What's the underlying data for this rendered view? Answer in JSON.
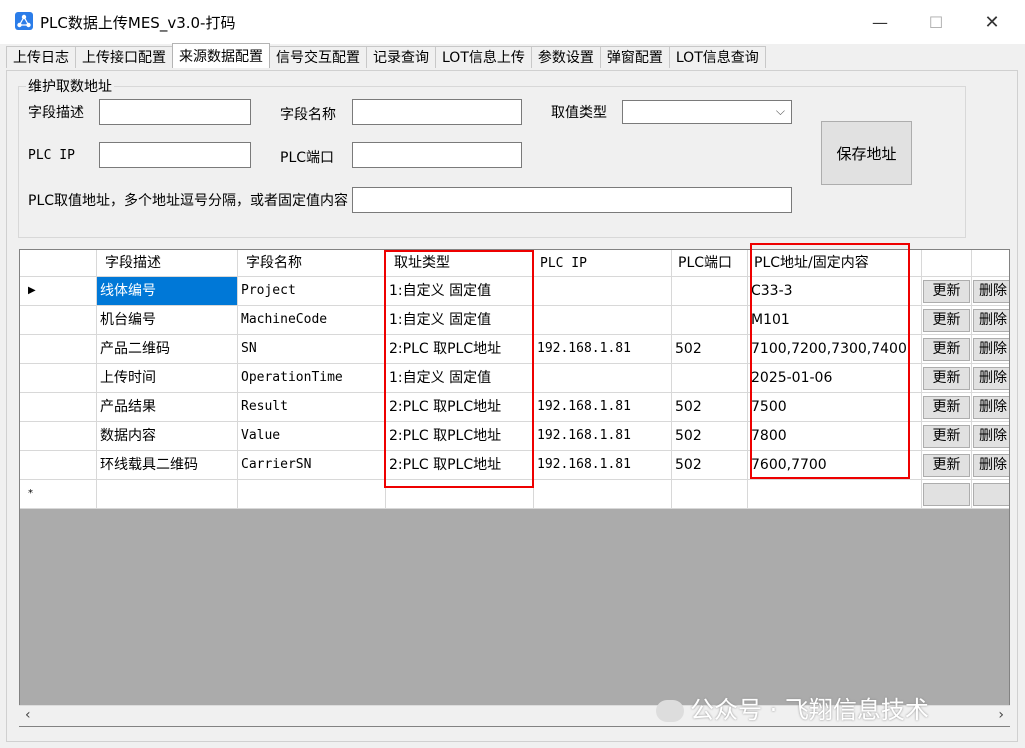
{
  "window": {
    "title": "PLC数据上传MES_v3.0-打码",
    "min": "—",
    "max": "☐",
    "close": "✕"
  },
  "tabs": [
    "上传日志",
    "上传接口配置",
    "来源数据配置",
    "信号交互配置",
    "记录查询",
    "LOT信息上传",
    "参数设置",
    "弹窗配置",
    "LOT信息查询"
  ],
  "active_tab": 2,
  "form": {
    "group_title": "维护取数地址",
    "field_desc_label": "字段描述",
    "field_name_label": "字段名称",
    "value_type_label": "取值类型",
    "plc_ip_label": "PLC IP",
    "plc_port_label": "PLC端口",
    "address_label": "PLC取值地址，多个地址逗号分隔，或者固定值内容",
    "save_label": "保存地址",
    "field_desc_value": "",
    "field_name_value": "",
    "value_type_value": "",
    "plc_ip_value": "",
    "plc_port_value": "",
    "address_value": ""
  },
  "table": {
    "headers": [
      "字段描述",
      "字段名称",
      "取址类型",
      "PLC IP",
      "PLC端口",
      "PLC地址/固定内容"
    ],
    "update_label": "更新",
    "delete_label": "删除",
    "rows": [
      {
        "desc": "线体编号",
        "name": "Project",
        "type": "1:自定义 固定值",
        "ip": "",
        "port": "",
        "addr": "C33-3"
      },
      {
        "desc": "机台编号",
        "name": "MachineCode",
        "type": "1:自定义 固定值",
        "ip": "",
        "port": "",
        "addr": "M101"
      },
      {
        "desc": "产品二维码",
        "name": "SN",
        "type": "2:PLC 取PLC地址",
        "ip": "192.168.1.81",
        "port": "502",
        "addr": "7100,7200,7300,7400"
      },
      {
        "desc": "上传时间",
        "name": "OperationTime",
        "type": "1:自定义 固定值",
        "ip": "",
        "port": "",
        "addr": "2025-01-06"
      },
      {
        "desc": "产品结果",
        "name": "Result",
        "type": "2:PLC 取PLC地址",
        "ip": "192.168.1.81",
        "port": "502",
        "addr": "7500"
      },
      {
        "desc": "数据内容",
        "name": "Value",
        "type": "2:PLC 取PLC地址",
        "ip": "192.168.1.81",
        "port": "502",
        "addr": "7800"
      },
      {
        "desc": "环线载具二维码",
        "name": "CarrierSN",
        "type": "2:PLC 取PLC地址",
        "ip": "192.168.1.81",
        "port": "502",
        "addr": "7600,7700"
      }
    ],
    "current_row_marker": "▶",
    "new_row_marker": "*"
  },
  "watermark": "公众号 · 飞翔信息技术"
}
